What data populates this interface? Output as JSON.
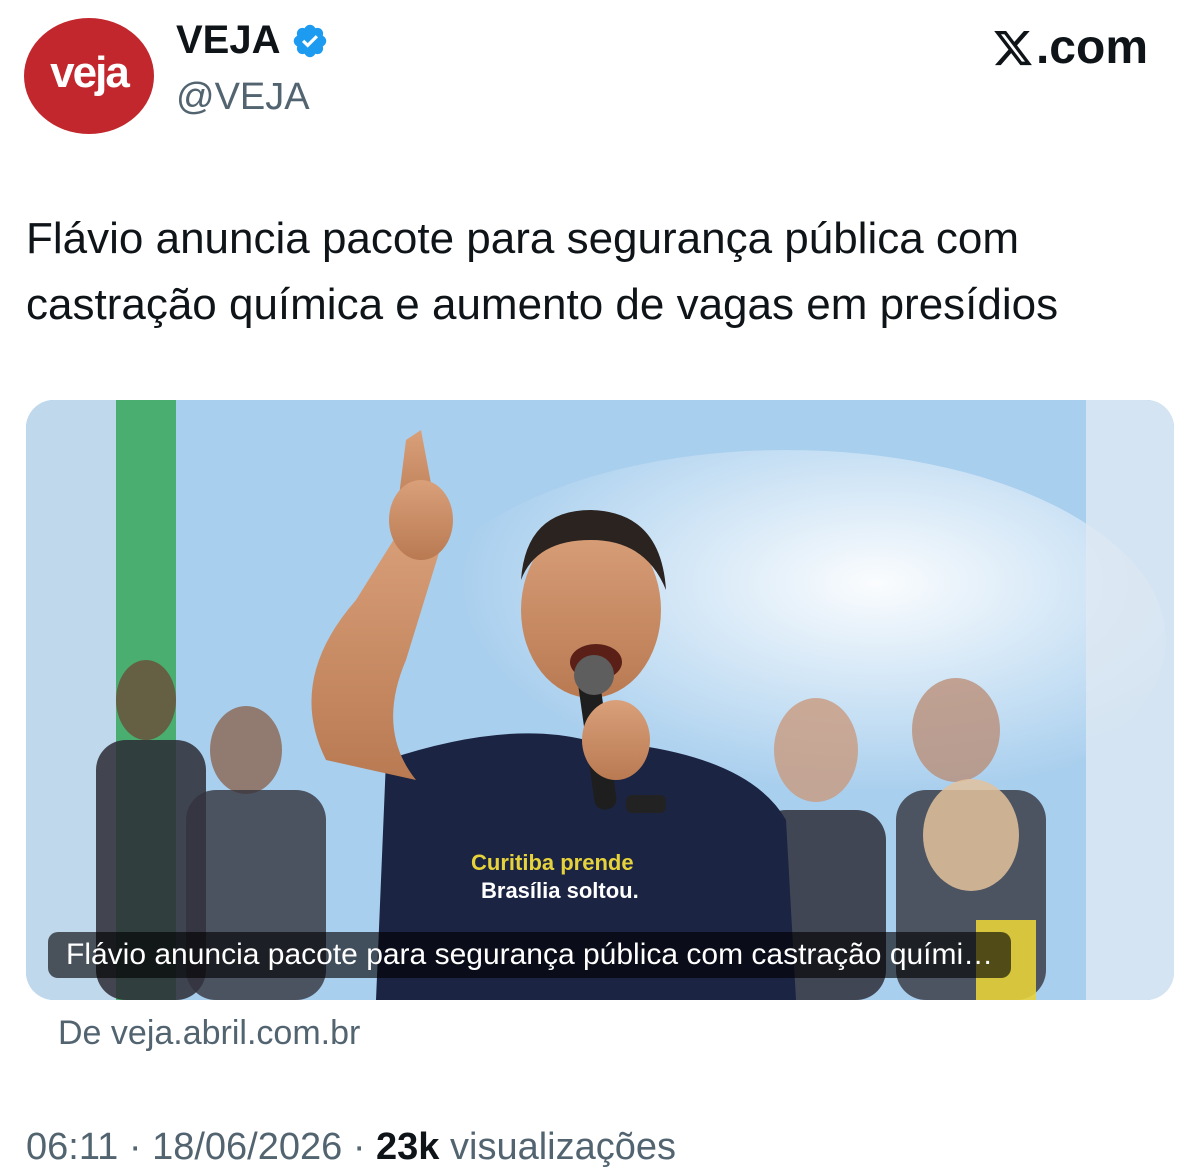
{
  "profile": {
    "avatar_text": "veja",
    "display_name": "VEJA",
    "handle": "@VEJA",
    "verified": true,
    "avatar_color": "#c1272d"
  },
  "brand": {
    "logo_text": ".com",
    "icon": "x-logo-icon"
  },
  "tweet": {
    "line1": "Flávio anuncia pacote para segurança pública com",
    "line2": "castração química e aumento de vagas em presídios"
  },
  "media": {
    "shirt_line1": "Curitiba prende",
    "shirt_line2": "Brasília soltou.",
    "caption": "Flávio anuncia pacote para segurança pública com castração quími…"
  },
  "source": {
    "label": "De veja.abril.com.br"
  },
  "meta": {
    "time": "06:11",
    "separator": "·",
    "date": "18/06/2026",
    "views_count": "23k",
    "views_label": "visualizações"
  },
  "colors": {
    "verified_blue": "#1d9bf0",
    "secondary_text": "#536471",
    "primary_text": "#0f1419"
  }
}
